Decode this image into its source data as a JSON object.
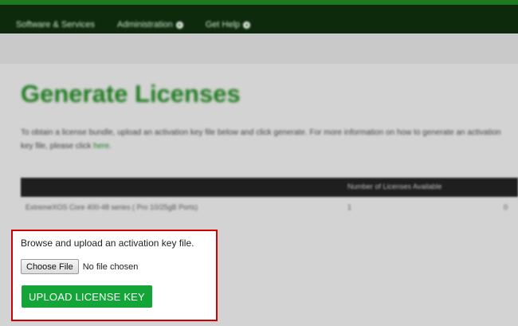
{
  "nav": {
    "items": [
      {
        "label": "Software & Services",
        "has_plus": false
      },
      {
        "label": "Administration",
        "has_plus": true
      },
      {
        "label": "Get Help",
        "has_plus": true
      }
    ]
  },
  "page": {
    "title": "Generate Licenses",
    "intro_text": "To obtain a license bundle, upload an activation key file below and click generate. For more information on how to generate an activation key file, please click ",
    "intro_link": "here",
    "intro_end": "."
  },
  "license_table": {
    "column_available": "Number of Licenses Available",
    "rows": [
      {
        "name": "ExtremeXOS Core 400-48 series ( Pro 10/25gB Ports)",
        "available": "1",
        "value": "0"
      }
    ]
  },
  "upload": {
    "instructions": "Browse and upload an activation key file.",
    "choose_label": "Choose File",
    "file_status": "No file chosen",
    "submit_label": "UPLOAD LICENSE KEY"
  },
  "colors": {
    "accent_green": "#13a538",
    "title_green": "#1e7a1e",
    "highlight_red": "#d10000",
    "nav_bg": "#0d2a0d"
  }
}
